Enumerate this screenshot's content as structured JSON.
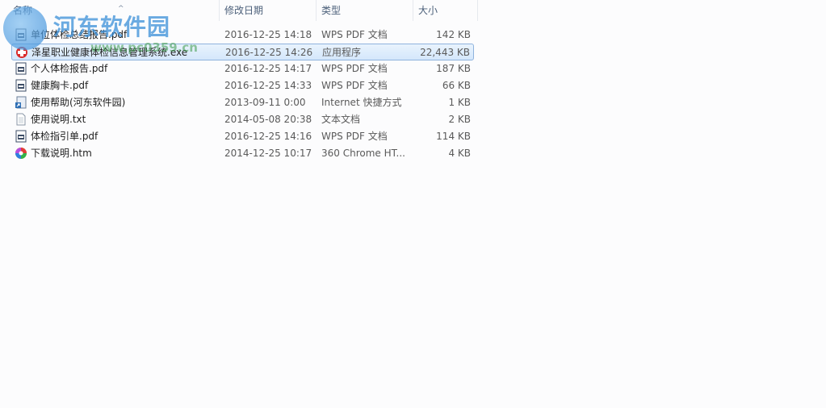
{
  "header": {
    "columns": [
      {
        "label": "名称",
        "sorted": true
      },
      {
        "label": "修改日期"
      },
      {
        "label": "类型"
      },
      {
        "label": "大小"
      }
    ],
    "sort_arrow": "^"
  },
  "files": [
    {
      "name": "单位体检总结报告.pdf",
      "date": "2016-12-25 14:18",
      "type": "WPS PDF 文档",
      "size": "142 KB",
      "icon": "pdf-icon",
      "selected": false
    },
    {
      "name": "泽星职业健康体检信息管理系统.exe",
      "date": "2016-12-25 14:26",
      "type": "应用程序",
      "size": "22,443 KB",
      "icon": "app-icon",
      "selected": true
    },
    {
      "name": "个人体检报告.pdf",
      "date": "2016-12-25 14:17",
      "type": "WPS PDF 文档",
      "size": "187 KB",
      "icon": "pdf-icon",
      "selected": false
    },
    {
      "name": "健康胸卡.pdf",
      "date": "2016-12-25 14:33",
      "type": "WPS PDF 文档",
      "size": "66 KB",
      "icon": "pdf-icon",
      "selected": false
    },
    {
      "name": "使用帮助(河东软件园)",
      "date": "2013-09-11 0:00",
      "type": "Internet 快捷方式",
      "size": "1 KB",
      "icon": "shortcut-icon",
      "selected": false
    },
    {
      "name": "使用说明.txt",
      "date": "2014-05-08 20:38",
      "type": "文本文档",
      "size": "2 KB",
      "icon": "text-file-icon",
      "selected": false
    },
    {
      "name": "体检指引单.pdf",
      "date": "2016-12-25 14:16",
      "type": "WPS PDF 文档",
      "size": "114 KB",
      "icon": "pdf-icon",
      "selected": false
    },
    {
      "name": "下载说明.htm",
      "date": "2014-12-25 10:17",
      "type": "360 Chrome HT...",
      "size": "4 KB",
      "icon": "chrome-html-icon",
      "selected": false
    }
  ],
  "watermark": {
    "title": "河东软件园",
    "url": "www.pc0359.cn"
  },
  "colors": {
    "selection_bg": "#d4e7fb",
    "selection_border": "#8fb3dd",
    "header_text": "#4c607a",
    "background": "#fcfcfd"
  }
}
